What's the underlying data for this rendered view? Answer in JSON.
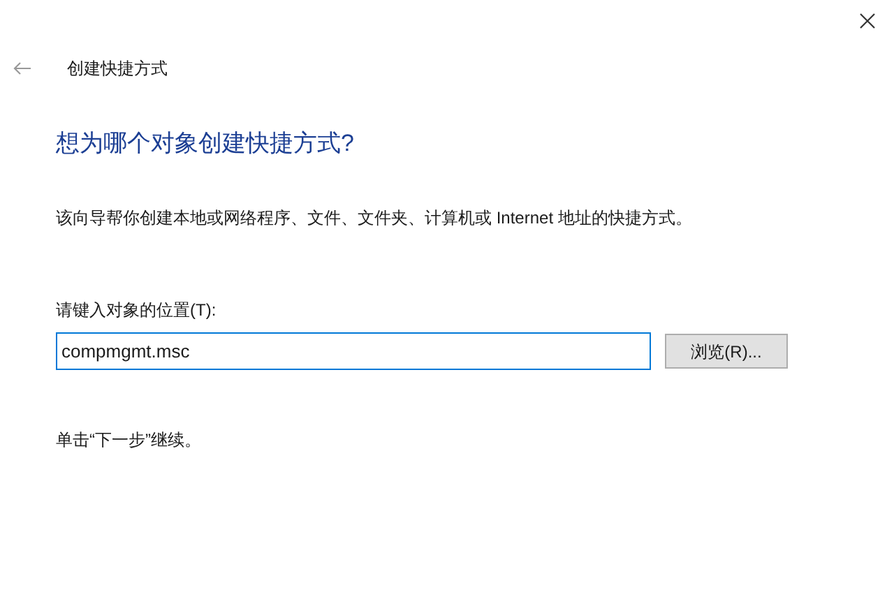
{
  "window": {
    "title": "创建快捷方式"
  },
  "heading": "想为哪个对象创建快捷方式?",
  "description": "该向导帮你创建本地或网络程序、文件、文件夹、计算机或 Internet 地址的快捷方式。",
  "location": {
    "label": "请键入对象的位置(T):",
    "value": "compmgmt.msc"
  },
  "browse_button": "浏览(R)...",
  "hint": "单击“下一步”继续。"
}
